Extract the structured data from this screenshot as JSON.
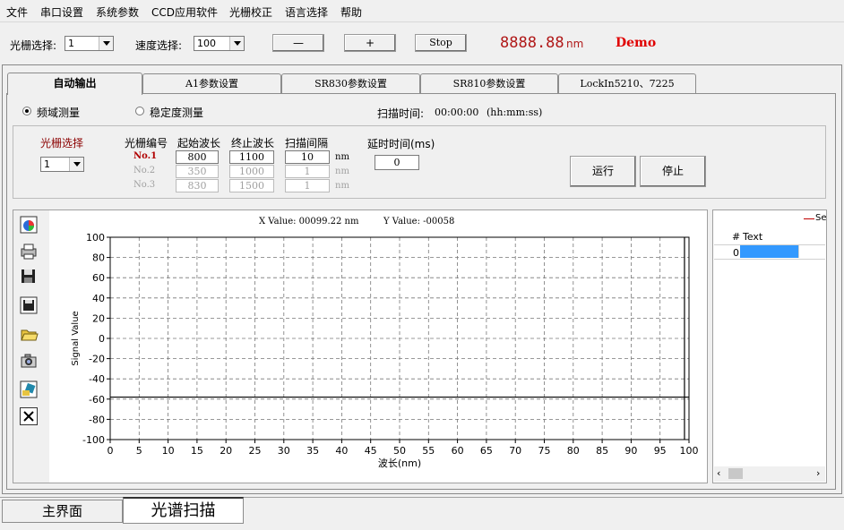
{
  "menu": [
    "文件",
    "串口设置",
    "系统参数",
    "CCD应用软件",
    "光栅校正",
    "语言选择",
    "帮助"
  ],
  "toolbar": {
    "grating_label": "光栅选择:",
    "grating_value": "1",
    "speed_label": "速度选择:",
    "speed_value": "100",
    "minus_label": "—",
    "plus_label": "+",
    "stop_label": "Stop",
    "wavelength_value": "8888.88",
    "wavelength_unit": "nm",
    "demo_label": "Demo"
  },
  "tabs": [
    "自动输出",
    "A1参数设置",
    "SR830参数设置",
    "SR810参数设置",
    "LockIn5210、7225"
  ],
  "mode": {
    "option1": "频域测量",
    "option2": "稳定度测量",
    "scan_time_label": "扫描时间:",
    "scan_time_value": "00:00:00",
    "scan_time_format": "(hh:mm:ss)"
  },
  "params": {
    "grating_select_label": "光栅选择",
    "grating_select_value": "1",
    "col_headers": [
      "光栅编号",
      "起始波长",
      "终止波长",
      "扫描间隔"
    ],
    "rows": [
      {
        "label": "No.1",
        "start": "800",
        "end": "1100",
        "step": "10",
        "unit": "nm"
      },
      {
        "label": "No.2",
        "start": "350",
        "end": "1000",
        "step": "1",
        "unit": "nm"
      },
      {
        "label": "No.3",
        "start": "830",
        "end": "1500",
        "step": "1",
        "unit": "nm"
      }
    ],
    "delay_label": "延时时间(ms)",
    "delay_value": "0",
    "run_label": "运行",
    "stop_label": "停止"
  },
  "plot": {
    "readout_x": "X Value: 00099.22 nm",
    "readout_y": "Y Value: -00058"
  },
  "chart_data": {
    "type": "line",
    "xlabel": "波长(nm)",
    "ylabel": "Signal Value",
    "xlim": [
      0,
      100
    ],
    "ylim": [
      -100,
      100
    ],
    "xticks": [
      0,
      5,
      10,
      15,
      20,
      25,
      30,
      35,
      40,
      45,
      50,
      55,
      60,
      65,
      70,
      75,
      80,
      85,
      90,
      95,
      100
    ],
    "yticks": [
      100,
      80,
      60,
      40,
      20,
      0,
      -20,
      -40,
      -60,
      -80,
      -100
    ],
    "grid": true,
    "cursor_x": 99.22,
    "cursor_y": -58
  },
  "legend_panel": {
    "series_label": "Se",
    "col_index": "#",
    "col_text": "Text",
    "row_index": "0",
    "series_color": "#c00000",
    "cell_color": "#3399ff"
  },
  "bottom_tabs": [
    "主界面",
    "光谱扫描"
  ]
}
